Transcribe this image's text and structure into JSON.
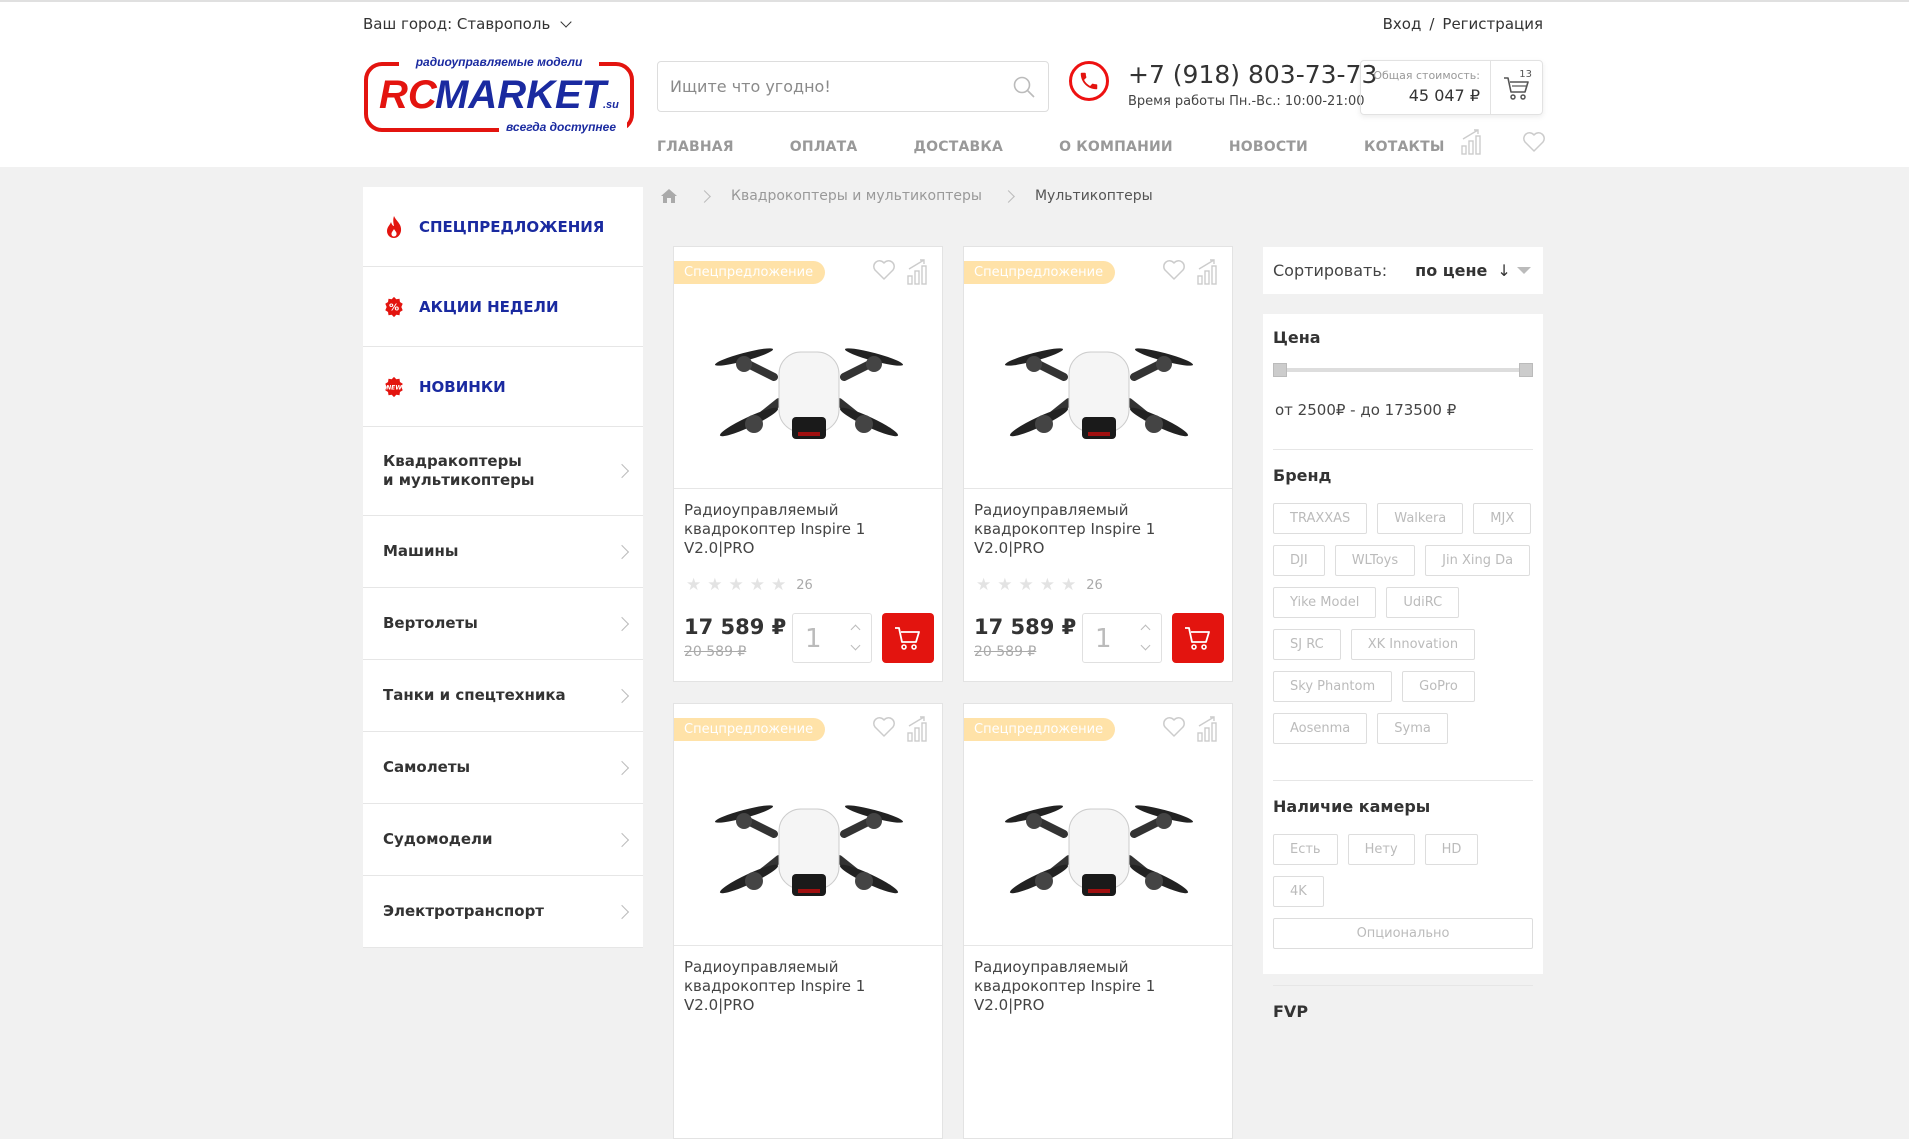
{
  "header": {
    "city_label": "Ваш город: Ставрополь",
    "login": "Вход",
    "auth_sep": "/",
    "register": "Регистрация",
    "logo": {
      "top": "радиоуправляемые модели",
      "brand_rc": "RC",
      "brand_market": "MARKET",
      "domain": ".su",
      "tagline": "всегда доступнее"
    },
    "search_placeholder": "Ищите что угодно!",
    "phone": "+7 (918) 803-73-73",
    "hours": "Время работы Пн.-Вс.: 10:00-21:00",
    "cart_total_label": "Общая стоимость:",
    "cart_total_value": "45 047 ₽",
    "cart_count": "13"
  },
  "nav": [
    "ГЛАВНАЯ",
    "ОПЛАТА",
    "ДОСТАВКА",
    "О КОМПАНИИ",
    "НОВОСТИ",
    "КОТАКТЫ"
  ],
  "sidebar": {
    "specials": [
      "СПЕЦПРЕДЛОЖЕНИЯ",
      "АКЦИИ НЕДЕЛИ",
      "НОВИНКИ"
    ],
    "new_badge": "NEW",
    "categories": [
      "Квадракоптеры\nи мультикоптеры",
      "Машины",
      "Вертолеты",
      "Танки и спецтехника",
      "Самолеты",
      "Судомодели",
      "Электротранспорт"
    ]
  },
  "breadcrumb": {
    "level1": "Квадрокоптеры и мультикоптеры",
    "current": "Мультикоптеры"
  },
  "products": [
    {
      "badge": "Спецпредложение",
      "title": "Радиоуправляемый квадрокоптер Inspire 1 V2.0|PRO",
      "reviews": "26",
      "price": "17 589 ₽",
      "old_price": "20 589 ₽",
      "qty": "1"
    },
    {
      "badge": "Спецпредложение",
      "title": "Радиоуправляемый квадрокоптер Inspire 1 V2.0|PRO",
      "reviews": "26",
      "price": "17 589 ₽",
      "old_price": "20 589 ₽",
      "qty": "1"
    },
    {
      "badge": "Спецпредложение",
      "title": "Радиоуправляемый квадрокоптер Inspire 1 V2.0|PRO"
    },
    {
      "badge": "Спецпредложение",
      "title": "Радиоуправляемый квадрокоптер Inspire 1 V2.0|PRO"
    }
  ],
  "sort": {
    "label": "Сортировать:",
    "value": "по цене",
    "arrow": "↓"
  },
  "filters": {
    "price_title": "Цена",
    "price_range": "от 2500₽ - до 173500 ₽",
    "brand_title": "Бренд",
    "brands": [
      "TRAXXAS",
      "Walkera",
      "MJX",
      "DJI",
      "WLToys",
      "Jin Xing Da",
      "Yike Model",
      "UdiRC",
      "SJ RC",
      "XK Innovation",
      "Sky Phantom",
      "GoPro",
      "Aosenma",
      "Syma"
    ],
    "camera_title": "Наличие камеры",
    "camera": [
      "Есть",
      "Нету",
      "HD",
      "4K"
    ],
    "camera_optional": "Опционально",
    "fvp_title": "FVP"
  },
  "colors": {
    "accent_red": "#e3140f",
    "brand_blue": "#1a2aa0",
    "badge_bg": "#ffe2a8"
  }
}
